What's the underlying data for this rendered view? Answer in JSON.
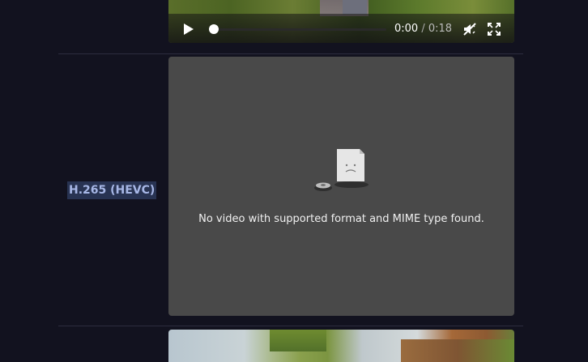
{
  "top_video": {
    "current_time": "0:00",
    "separator": "/",
    "duration": "0:18",
    "progress_fraction": 0.0,
    "icons": {
      "play": "play-icon",
      "mute": "mute-icon",
      "fullscreen": "fullscreen-icon"
    }
  },
  "row": {
    "codec_label": "H.265 (HEVC)"
  },
  "error_video": {
    "message": "No video with supported format and MIME type found.",
    "icon": "broken-file-icon"
  },
  "colors": {
    "page_background": "#12121f",
    "label_background": "#283352",
    "label_text": "#a7b7e6",
    "error_panel": "#494949"
  }
}
